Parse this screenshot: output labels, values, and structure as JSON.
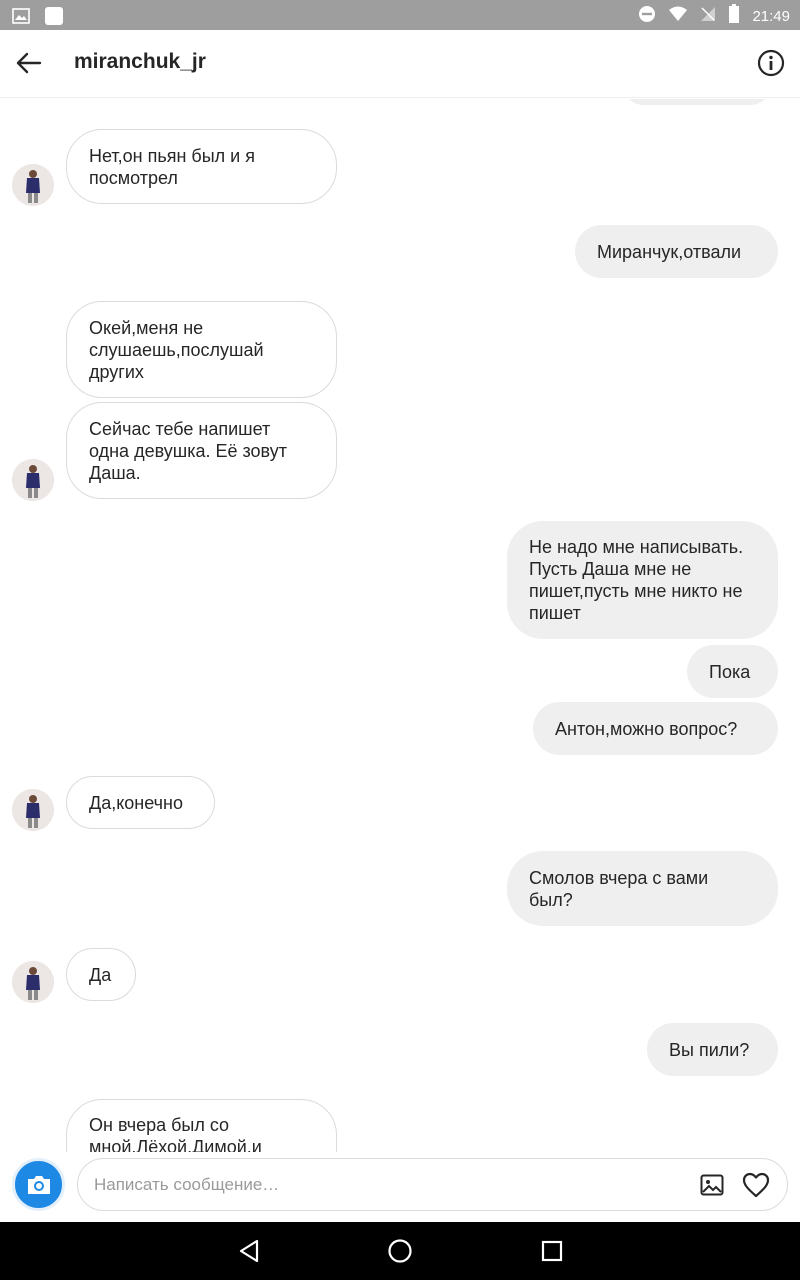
{
  "status_bar": {
    "time": "21:49"
  },
  "header": {
    "title": "miranchuk_jr"
  },
  "messages": [
    {
      "dir": "in",
      "text": "Нет,он пьян был и я посмотрел"
    },
    {
      "dir": "out",
      "text": "Миранчук,отвали"
    },
    {
      "dir": "in",
      "text": "Окей,меня не слушаешь,послушай других"
    },
    {
      "dir": "in",
      "text": "Сейчас тебе напишет одна девушка. Её зовут Даша."
    },
    {
      "dir": "out",
      "text": "Не надо мне написывать. Пусть Даша мне не пишет,пусть мне никто не пишет"
    },
    {
      "dir": "out",
      "text": "Пока"
    },
    {
      "dir": "out",
      "text": "Антон,можно вопрос?"
    },
    {
      "dir": "in",
      "text": "Да,конечно"
    },
    {
      "dir": "out",
      "text": "Смолов вчера с вами был?"
    },
    {
      "dir": "in",
      "text": "Да"
    },
    {
      "dir": "out",
      "text": "Вы пили?"
    },
    {
      "dir": "in",
      "text": "Он вчера был со мной.Лёхой.Димой.и"
    }
  ],
  "composer": {
    "placeholder": "Написать сообщение…",
    "value": ""
  },
  "icons": {
    "back": "arrow-left-icon",
    "info": "info-icon",
    "camera": "camera-icon",
    "gallery": "image-icon",
    "like": "heart-icon",
    "nav_back": "triangle-back-icon",
    "nav_home": "circle-home-icon",
    "nav_recents": "square-recents-icon"
  },
  "colors": {
    "outgoing_bubble": "#efefef",
    "incoming_border": "#dbdbdb",
    "camera_button": "#1e88e5",
    "status_bar": "#9e9e9e",
    "nav_bar": "#000000"
  }
}
